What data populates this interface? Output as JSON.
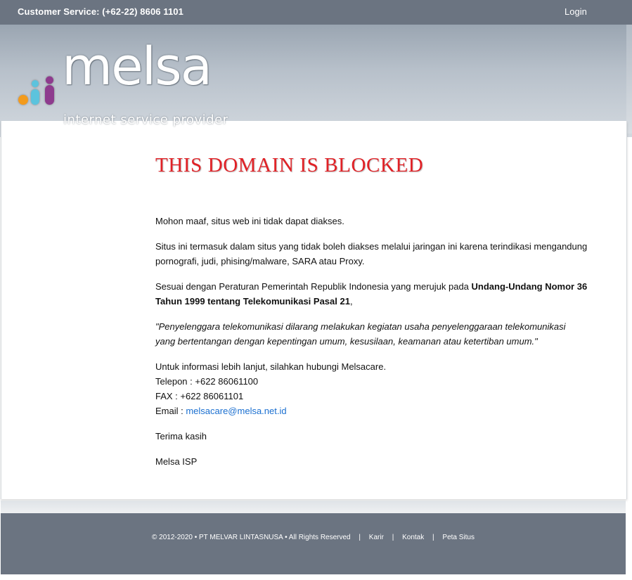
{
  "topbar": {
    "customer_service": "Customer Service: (+62-22) 8606 1101",
    "login": "Login"
  },
  "logo": {
    "word": "melsa",
    "tagline": "internet service provider",
    "dot_colors": [
      "#f39b1f",
      "#5bc3dd",
      "#8e3b8e"
    ]
  },
  "main": {
    "title": "THIS DOMAIN IS BLOCKED",
    "p1": "Mohon maaf, situs web ini tidak dapat diakses.",
    "p2": "Situs ini termasuk dalam situs yang tidak boleh diakses melalui jaringan ini karena terindikasi mengandung pornografi, judi, phising/malware, SARA atau Proxy.",
    "p3_prefix": "Sesuai dengan Peraturan Pemerintah Republik Indonesia yang merujuk pada ",
    "p3_bold": "Undang-Undang Nomor 36 Tahun 1999 tentang Telekomunikasi Pasal 21",
    "p3_suffix": ",",
    "quote": "\"Penyelenggara telekomunikasi dilarang melakukan kegiatan usaha penyelenggaraan telekomunikasi yang bertentangan dengan kepentingan umum, kesusilaan, keamanan atau ketertiban umum.\"",
    "info": "Untuk informasi lebih lanjut, silahkan hubungi Melsacare.",
    "phone": "Telepon : +622 86061100",
    "fax": "FAX : +622 86061101",
    "email_label": "Email : ",
    "email": "melsacare@melsa.net.id",
    "thanks": "Terima kasih",
    "signature": "Melsa ISP"
  },
  "footer": {
    "copyright": "© 2012-2020 • PT MELVAR LINTASNUSA • All Rights Reserved",
    "separator": "|",
    "links": [
      "Karir",
      "Kontak",
      "Peta Situs"
    ]
  },
  "colors": {
    "bar": "#6b7481",
    "title": "#e12126",
    "link": "#1a6fd0"
  }
}
